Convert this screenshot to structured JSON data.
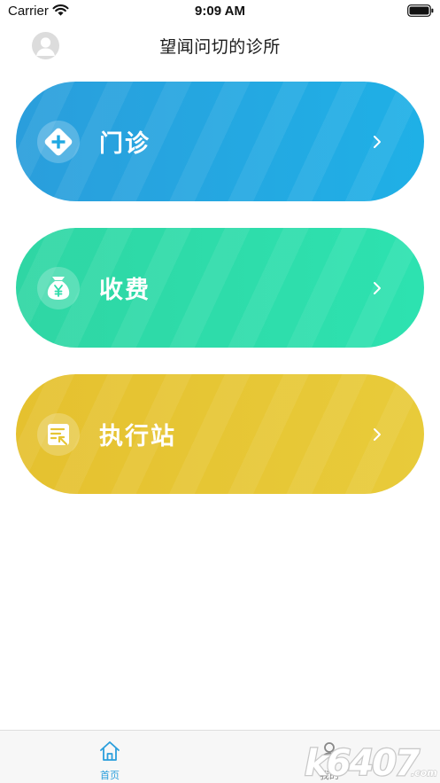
{
  "status_bar": {
    "carrier": "Carrier",
    "time": "9:09 AM"
  },
  "nav": {
    "title": "望闻问切的诊所"
  },
  "cards": [
    {
      "label": "门诊",
      "icon": "medical-cross-icon",
      "color": "#1fa8e2"
    },
    {
      "label": "收费",
      "icon": "money-bag-icon",
      "color": "#2edcaa"
    },
    {
      "label": "执行站",
      "icon": "task-list-icon",
      "color": "#e6c534"
    }
  ],
  "tabs": [
    {
      "label": "首页",
      "icon": "home-icon",
      "active": true
    },
    {
      "label": "我的",
      "icon": "person-icon",
      "active": false
    }
  ],
  "colors": {
    "accent": "#2a9edc",
    "inactive": "#888888"
  },
  "watermark": {
    "text": "k6407.com"
  }
}
